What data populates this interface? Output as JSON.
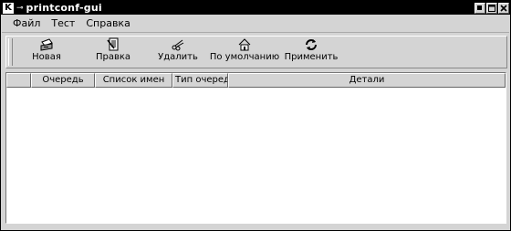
{
  "window": {
    "title": "printconf-gui",
    "app_icon_letter": "K"
  },
  "menu": [
    "Файл",
    "Тест",
    "Справка"
  ],
  "toolbar": [
    {
      "label": "Новая",
      "icon": "new-printer-icon"
    },
    {
      "label": "Правка",
      "icon": "edit-icon"
    },
    {
      "label": "Удалить",
      "icon": "scissors-icon"
    },
    {
      "label": "По умолчанию",
      "icon": "home-icon"
    },
    {
      "label": "Применить",
      "icon": "apply-arrows-icon"
    }
  ],
  "table": {
    "columns": [
      "",
      "Очередь",
      "Список имен",
      "Тип очереди",
      "Детали"
    ],
    "rows": []
  }
}
